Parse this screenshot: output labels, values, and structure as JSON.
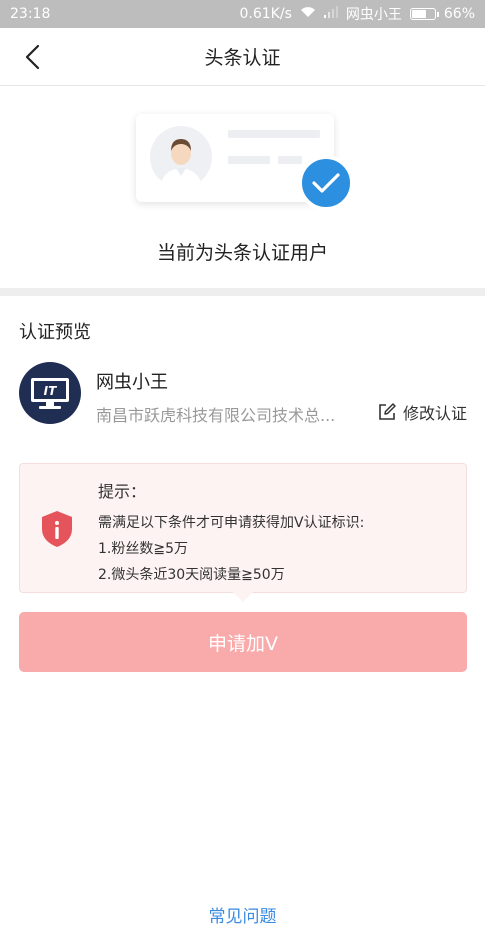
{
  "status_bar": {
    "time": "23:18",
    "speed": "0.61K/s",
    "carrier": "网虫小王",
    "battery": "66%",
    "battery_level": 0.66
  },
  "nav": {
    "back_icon": "chevron-left-icon",
    "title": "头条认证"
  },
  "hero": {
    "caption": "当前为头条认证用户",
    "badge_icon": "check-icon",
    "accent_color": "#2d8fe0"
  },
  "preview": {
    "title": "认证预览",
    "logo_text": "IT",
    "name": "网虫小王",
    "company": "南昌市跃虎科技有限公司技术总...",
    "edit_label": "修改认证",
    "edit_icon": "edit-icon"
  },
  "tip": {
    "title": "提示：",
    "line1": "需满足以下条件才可申请获得加V认证标识:",
    "line2": "1.粉丝数≧5万",
    "line3": "2.微头条近30天阅读量≧50万",
    "icon": "shield-alert-icon",
    "icon_color": "#e5545a"
  },
  "apply_button": {
    "label": "申请加V",
    "color": "#f9aaaa"
  },
  "footer": {
    "faq_label": "常见问题",
    "link_color": "#3a8ae0"
  }
}
